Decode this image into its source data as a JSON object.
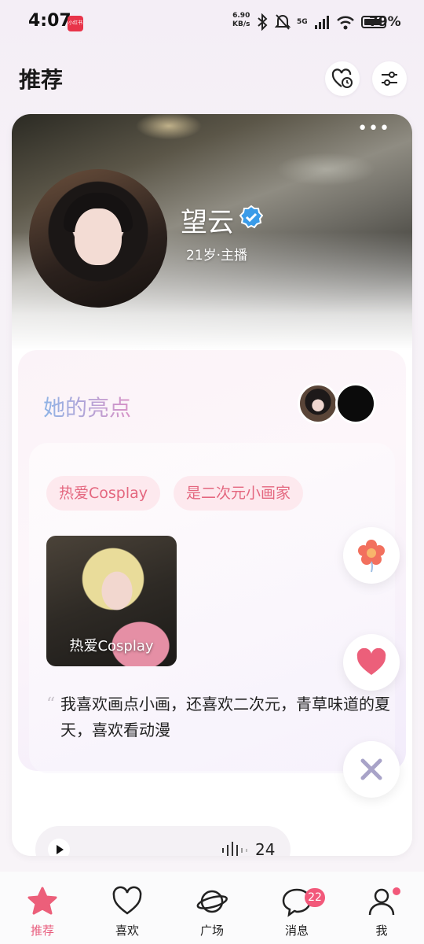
{
  "status_bar": {
    "time": "4:07",
    "app_icon_text": "小红书",
    "net_speed_value": "6.90",
    "net_speed_unit": "KB/s",
    "signal_label": "5G",
    "battery_percent": "79%"
  },
  "header": {
    "title": "推荐",
    "icons": [
      "heart-clock-icon",
      "filter-sliders-icon"
    ]
  },
  "profile": {
    "name": "望云",
    "meta": "21岁·主播",
    "verified": true
  },
  "highlights": {
    "title": "她的亮点",
    "tags": [
      "热爱Cosplay",
      "是二次元小画家"
    ],
    "photo_label": "热爱Cosplay",
    "quote_mark": "“",
    "quote": "我喜欢画点小画，还喜欢二次元，青草味道的夏天，喜欢看动漫"
  },
  "audio": {
    "seconds": "24"
  },
  "floating_actions": [
    "flower-icon",
    "heart-icon",
    "close-icon"
  ],
  "bottom_nav": {
    "items": [
      {
        "label": "推荐",
        "icon": "star-icon",
        "active": true
      },
      {
        "label": "喜欢",
        "icon": "heart-outline-icon",
        "active": false
      },
      {
        "label": "广场",
        "icon": "planet-icon",
        "active": false
      },
      {
        "label": "消息",
        "icon": "chat-bubble-icon",
        "active": false
      },
      {
        "label": "我",
        "icon": "person-icon",
        "active": false
      }
    ],
    "message_badge": "22"
  },
  "colors": {
    "accent_pink": "#e85c7d",
    "tag_bg": "#fde9ee",
    "tag_text": "#e4677f",
    "verified_blue": "#3a9be8"
  }
}
